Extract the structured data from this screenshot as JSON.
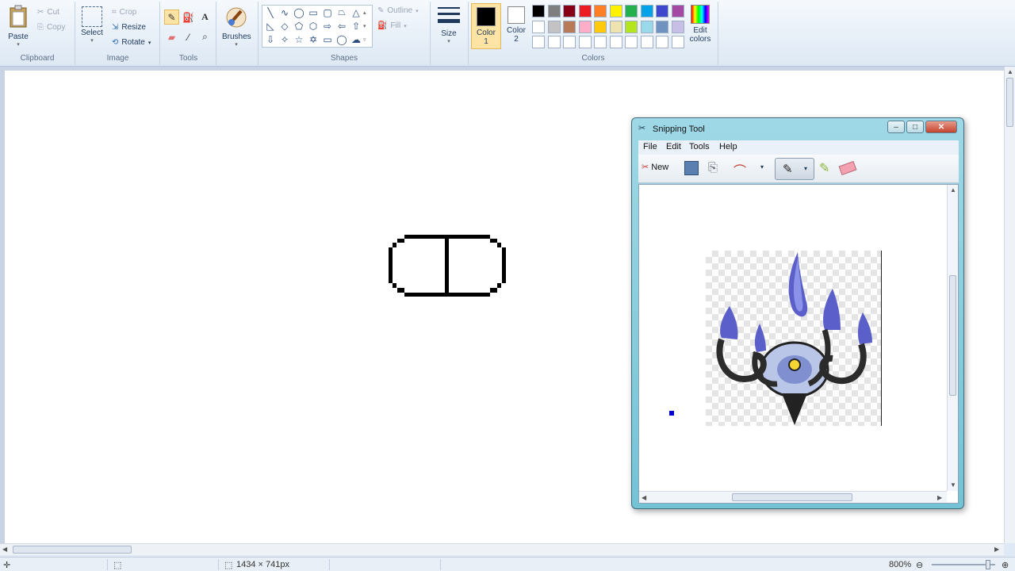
{
  "ribbon": {
    "clipboard": {
      "label": "Clipboard",
      "paste": "Paste",
      "cut": "Cut",
      "copy": "Copy"
    },
    "image": {
      "label": "Image",
      "select": "Select",
      "crop": "Crop",
      "resize": "Resize",
      "rotate": "Rotate"
    },
    "tools": {
      "label": "Tools"
    },
    "brushes": "Brushes",
    "shapes": {
      "label": "Shapes",
      "outline": "Outline",
      "fill": "Fill"
    },
    "size": "Size",
    "color1": {
      "line1": "Color",
      "line2": "1",
      "value": "#000000"
    },
    "color2": {
      "line1": "Color",
      "line2": "2",
      "value": "#ffffff"
    },
    "colors_label": "Colors",
    "edit_colors": {
      "line1": "Edit",
      "line2": "colors"
    },
    "palette_row1": [
      "#000000",
      "#7f7f7f",
      "#880015",
      "#ed1c24",
      "#ff7f27",
      "#fff200",
      "#22b14c",
      "#00a2e8",
      "#3f48cc",
      "#a349a4"
    ],
    "palette_row2": [
      "#ffffff",
      "#c3c3c3",
      "#b97a57",
      "#ffaec9",
      "#ffc90e",
      "#efe4b0",
      "#b5e61d",
      "#99d9ea",
      "#7092be",
      "#c8bfe7"
    ]
  },
  "status": {
    "size": "1434 × 741px",
    "zoom": "800%"
  },
  "snipping": {
    "title": "Snipping Tool",
    "menu": [
      "File",
      "Edit",
      "Tools",
      "Help"
    ],
    "new_label": "New",
    "pen_color": "#0000cc"
  }
}
